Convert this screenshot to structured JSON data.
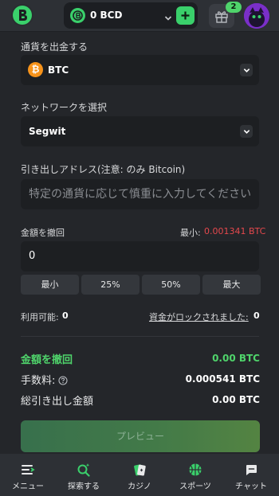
{
  "header": {
    "wallet_balance": "0 BCD",
    "gift_badge": "2"
  },
  "withdraw": {
    "currency_label": "通貨を出金する",
    "currency_value": "BTC",
    "network_label": "ネットワークを選択",
    "network_value": "Segwit",
    "address_label": "引き出しアドレス(注意: のみ Bitcoin)",
    "address_placeholder": "特定の通貨に応じて慎重に入力してください",
    "amount_label": "金額を撤回",
    "min_label": "最小:",
    "min_value": "0.001341 BTC",
    "amount_value": "0",
    "quick_buttons": [
      "最小",
      "25%",
      "50%",
      "最大"
    ],
    "available_label": "利用可能:",
    "available_value": "0",
    "locked_label": "資金がロックされました:",
    "locked_value": "0",
    "summary": {
      "withdraw_label": "金額を撤回",
      "withdraw_value": "0.00 BTC",
      "fee_label": "手数料:",
      "fee_value": "0.000541 BTC",
      "total_label": "総引き出し金額",
      "total_value": "0.00 BTC"
    },
    "preview_button": "プレビュー"
  },
  "bottom_nav": [
    {
      "label": "メニュー",
      "icon": "menu-icon"
    },
    {
      "label": "探索する",
      "icon": "search-icon"
    },
    {
      "label": "カジノ",
      "icon": "cards-icon"
    },
    {
      "label": "スポーツ",
      "icon": "basketball-icon"
    },
    {
      "label": "チャット",
      "icon": "chat-icon"
    }
  ],
  "colors": {
    "accent_green": "#3ad06b",
    "min_red": "#e5484d",
    "summary_green": "#4fd46b"
  }
}
